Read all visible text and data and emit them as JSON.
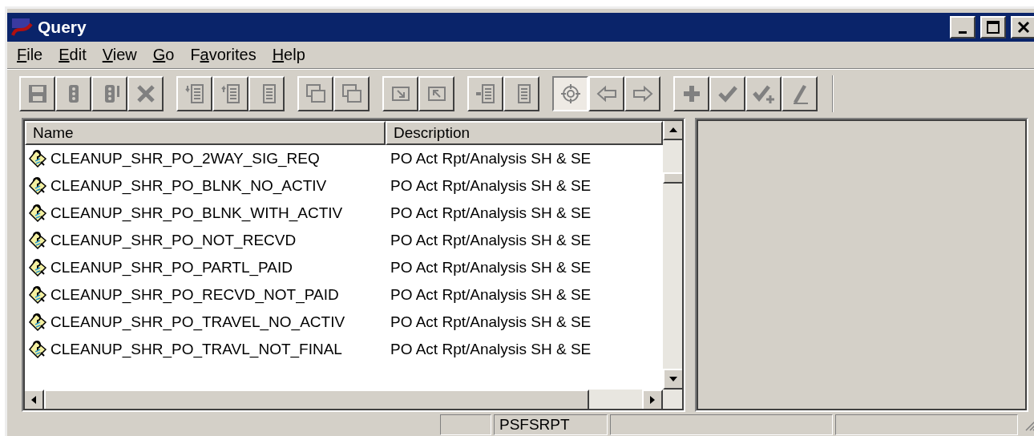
{
  "window": {
    "title": "Query"
  },
  "menu": [
    {
      "key": "F",
      "post": "ile"
    },
    {
      "key": "E",
      "post": "dit"
    },
    {
      "key": "V",
      "post": "iew"
    },
    {
      "key": "G",
      "post": "o"
    },
    {
      "pre": "F",
      "key": "a",
      "post": "vorites"
    },
    {
      "key": "H",
      "post": "elp"
    }
  ],
  "toolbar": [
    [
      {
        "pressed": false
      },
      {
        "pressed": false
      },
      {
        "pressed": false
      },
      {
        "pressed": false
      }
    ],
    [
      {
        "pressed": false
      },
      {
        "pressed": false
      },
      {
        "pressed": false
      }
    ],
    [
      {
        "pressed": false
      },
      {
        "pressed": false
      }
    ],
    [
      {
        "pressed": false
      },
      {
        "pressed": false
      }
    ],
    [
      {
        "pressed": false
      },
      {
        "pressed": false
      }
    ],
    [
      {
        "pressed": true
      },
      {
        "pressed": false
      },
      {
        "pressed": false
      }
    ],
    [
      {
        "pressed": false
      },
      {
        "pressed": false
      },
      {
        "pressed": false
      },
      {
        "pressed": false
      }
    ]
  ],
  "list": {
    "columns": [
      "Name",
      "Description"
    ],
    "rows": [
      [
        "CLEANUP_SHR_PO_2WAY_SIG_REQ",
        "PO Act Rpt/Analysis SH & SE"
      ],
      [
        "CLEANUP_SHR_PO_BLNK_NO_ACTIV",
        "PO Act Rpt/Analysis SH & SE"
      ],
      [
        "CLEANUP_SHR_PO_BLNK_WITH_ACTIV",
        "PO Act Rpt/Analysis SH & SE"
      ],
      [
        "CLEANUP_SHR_PO_NOT_RECVD",
        "PO Act Rpt/Analysis SH & SE"
      ],
      [
        "CLEANUP_SHR_PO_PARTL_PAID",
        "PO Act Rpt/Analysis SH & SE"
      ],
      [
        "CLEANUP_SHR_PO_RECVD_NOT_PAID",
        "PO Act Rpt/Analysis SH & SE"
      ],
      [
        "CLEANUP_SHR_PO_TRAVEL_NO_ACTIV",
        "PO Act Rpt/Analysis SH & SE"
      ],
      [
        "CLEANUP_SHR_PO_TRAVL_NOT_FINAL",
        "PO Act Rpt/Analysis SH & SE"
      ]
    ]
  },
  "status_bar": {
    "user": "PSFSRPT"
  }
}
